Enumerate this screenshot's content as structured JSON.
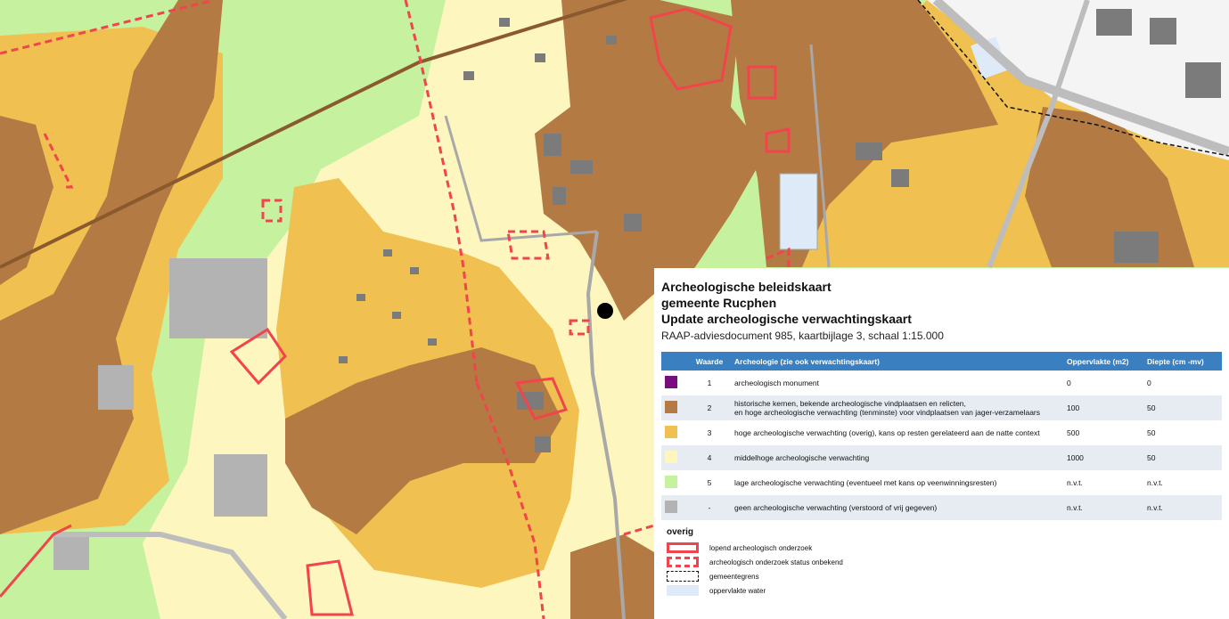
{
  "legend": {
    "title_lines": [
      "Archeologische beleidskaart",
      "gemeente Rucphen",
      "Update archeologische verwachtingskaart"
    ],
    "subtitle": "RAAP-adviesdocument 985, kaartbijlage 3, schaal 1:15.000",
    "headers": {
      "waarde": "Waarde",
      "archeologie": "Archeologie (zie ook verwachtingskaart)",
      "oppervlakte": "Oppervlakte (m2)",
      "diepte": "Diepte (cm -mv)"
    },
    "rows": [
      {
        "color": "#7a0d7e",
        "waarde": "1",
        "text_1": "archeologisch monument",
        "text_2": "",
        "oppervlakte": "0",
        "diepte": "0"
      },
      {
        "color": "#b47a43",
        "waarde": "2",
        "text_1": "historische kernen, bekende archeologische vindplaatsen en relicten,",
        "text_2": "en hoge archeologische verwachting (tenminste) voor vindplaatsen van jager-verzamelaars",
        "oppervlakte": "100",
        "diepte": "50"
      },
      {
        "color": "#f0c050",
        "waarde": "3",
        "text_1": "hoge archeologische verwachting (overig), kans op resten gerelateerd aan de natte context",
        "text_2": "",
        "oppervlakte": "500",
        "diepte": "50"
      },
      {
        "color": "#fdf6bf",
        "waarde": "4",
        "text_1": "middelhoge archeologische verwachting",
        "text_2": "",
        "oppervlakte": "1000",
        "diepte": "50"
      },
      {
        "color": "#c6f29f",
        "waarde": "5",
        "text_1": "lage archeologische verwachting (eventueel met kans op veenwinningsresten)",
        "text_2": "",
        "oppervlakte": "n.v.t.",
        "diepte": "n.v.t."
      },
      {
        "color": "#b3b3b3",
        "waarde": "-",
        "text_1": "geen archeologische verwachting (verstoord of vrij gegeven)",
        "text_2": "",
        "oppervlakte": "n.v.t.",
        "diepte": "n.v.t."
      }
    ],
    "overig_title": "overig",
    "overig_items": [
      "lopend archeologisch onderzoek",
      "archeologisch onderzoek status onbekend",
      "gemeentegrens",
      "oppervlakte water"
    ]
  },
  "colors": {
    "monument": "#7a0d7e",
    "historic_core": "#b47a43",
    "high": "#f0c050",
    "medium_high": "#fdf6bf",
    "low": "#c6f29f",
    "none": "#b3b3b3",
    "building": "#7b7b7b",
    "research": "#f2444c",
    "header_blue": "#3a7fbf",
    "water": "#deeaf7"
  }
}
